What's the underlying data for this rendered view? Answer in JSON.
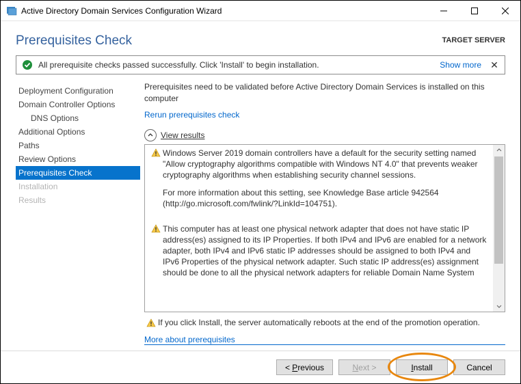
{
  "window": {
    "title": "Active Directory Domain Services Configuration Wizard"
  },
  "header": {
    "page_title": "Prerequisites Check",
    "target_server_label": "TARGET SERVER"
  },
  "banner": {
    "text": "All prerequisite checks passed successfully.  Click 'Install' to begin installation.",
    "show_more": "Show more"
  },
  "sidebar": {
    "items": [
      {
        "label": "Deployment Configuration"
      },
      {
        "label": "Domain Controller Options"
      },
      {
        "label": "DNS Options"
      },
      {
        "label": "Additional Options"
      },
      {
        "label": "Paths"
      },
      {
        "label": "Review Options"
      },
      {
        "label": "Prerequisites Check"
      },
      {
        "label": "Installation"
      },
      {
        "label": "Results"
      }
    ]
  },
  "main": {
    "intro": "Prerequisites need to be validated before Active Directory Domain Services is installed on this computer",
    "rerun_link": "Rerun prerequisites check",
    "view_results_label": "View results",
    "results": [
      {
        "paragraphs": [
          "Windows Server 2019 domain controllers have a default for the security setting named \"Allow cryptography algorithms compatible with Windows NT 4.0\" that prevents weaker cryptography algorithms when establishing security channel sessions.",
          "For more information about this setting, see Knowledge Base article 942564 (http://go.microsoft.com/fwlink/?LinkId=104751)."
        ]
      },
      {
        "paragraphs": [
          "This computer has at least one physical network adapter that does not have static IP address(es) assigned to its IP Properties. If both IPv4 and IPv6 are enabled for a network adapter, both IPv4 and IPv6 static IP addresses should be assigned to both IPv4 and IPv6 Properties of the physical network adapter. Such static IP address(es) assignment should be done to all the physical network adapters for reliable Domain Name System"
        ]
      }
    ],
    "footer_warning": "If you click Install, the server automatically reboots at the end of the promotion operation.",
    "more_link": "More about prerequisites"
  },
  "buttons": {
    "previous_u": "P",
    "previous_rest": "revious",
    "previous_prefix": "< ",
    "next_u": "N",
    "next_rest": "ext >",
    "install_u": "I",
    "install_rest": "nstall",
    "cancel": "Cancel"
  }
}
